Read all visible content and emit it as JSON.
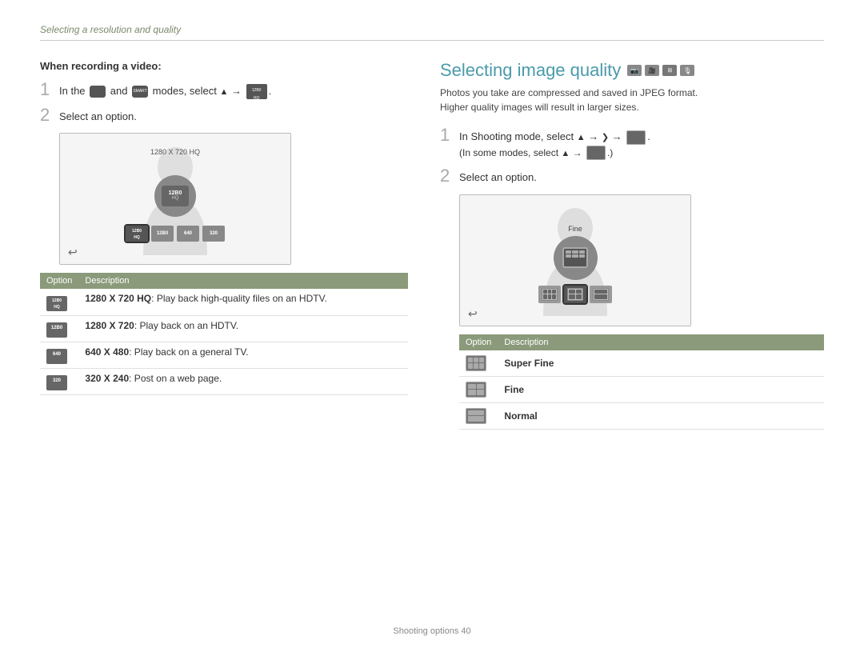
{
  "page": {
    "breadcrumb": "Selecting a resolution and quality",
    "footer": "Shooting options  40"
  },
  "left": {
    "when_recording": "When recording a video:",
    "step1": {
      "num": "1",
      "text": "In the  and  modes, select  →"
    },
    "step2": {
      "num": "2",
      "text": "Select an option."
    },
    "screen": {
      "resolution_label": "1280 X 720 HQ",
      "big_icon_line1": "12B0",
      "big_icon_line2": "HQ",
      "icons": [
        {
          "label": "12B0\nHQ",
          "active": true
        },
        {
          "label": "12B0"
        },
        {
          "label": "640"
        },
        {
          "label": "320"
        }
      ]
    },
    "table": {
      "headers": [
        "Option",
        "Description"
      ],
      "rows": [
        {
          "icon_text": "12B0\nHQ",
          "desc_bold": "1280 X 720 HQ",
          "desc": ": Play back high-quality files on an HDTV."
        },
        {
          "icon_text": "12B0",
          "desc_bold": "1280 X 720",
          "desc": ": Play back on an HDTV."
        },
        {
          "icon_text": "640",
          "desc_bold": "640 X 480",
          "desc": ": Play back on a general TV."
        },
        {
          "icon_text": "320",
          "desc_bold": "320 X 240",
          "desc": ": Post on a web page."
        }
      ]
    }
  },
  "right": {
    "title": "Selecting image quality",
    "desc_line1": "Photos you take are compressed and saved in JPEG format.",
    "desc_line2": "Higher quality images will result in larger sizes.",
    "step1": {
      "num": "1",
      "text": "In Shooting mode, select  →  →",
      "sub": "(In some modes, select  →  .)"
    },
    "step2": {
      "num": "2",
      "text": "Select an option."
    },
    "screen": {
      "fine_label": "Fine",
      "icons": [
        {
          "label": "sf",
          "active": false
        },
        {
          "label": "f",
          "active": true
        },
        {
          "label": "n",
          "active": false
        }
      ]
    },
    "table": {
      "headers": [
        "Option",
        "Description"
      ],
      "rows": [
        {
          "icon": "sf",
          "label": "Super Fine"
        },
        {
          "icon": "f",
          "label": "Fine"
        },
        {
          "icon": "n",
          "label": "Normal"
        }
      ]
    }
  }
}
